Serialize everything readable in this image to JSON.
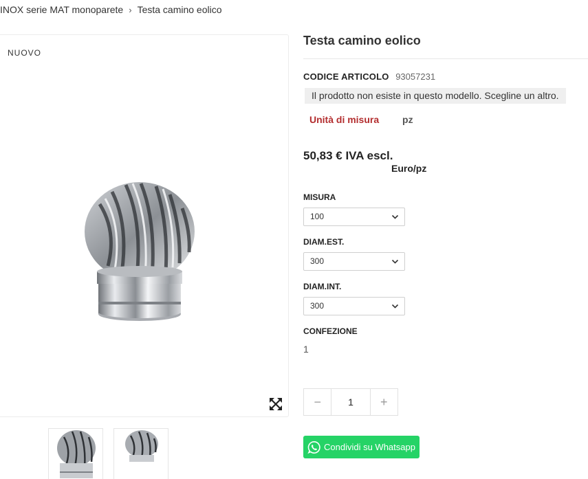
{
  "breadcrumb": {
    "items": [
      "INOX serie MAT monoparete",
      "Testa camino eolico"
    ],
    "separator": "›"
  },
  "gallery": {
    "badge": "NUOVO",
    "expand_icon": "expand-arrows-icon",
    "thumbnails": [
      "thumbnail-front",
      "thumbnail-angle"
    ]
  },
  "product": {
    "title": "Testa camino eolico",
    "reference_label": "CODICE ARTICOLO",
    "reference_value": "93057231",
    "availability_alert": "Il prodotto non esiste in questo modello. Scegline un altro.",
    "unit_label": "Unità di misura",
    "unit_value": "pz",
    "price": "50,83 € IVA escl.",
    "price_unit": "Euro/pz",
    "variants": [
      {
        "label": "MISURA",
        "value": "100"
      },
      {
        "label": "DIAM.EST.",
        "value": "300"
      },
      {
        "label": "DIAM.INT.",
        "value": "300"
      }
    ],
    "confezione_label": "CONFEZIONE",
    "confezione_value": "1",
    "quantity": {
      "value": "1",
      "minus": "−",
      "plus": "+"
    },
    "whatsapp_label": "Condividi su Whatsapp"
  },
  "colors": {
    "accent_red": "#b32d2e",
    "whatsapp_green": "#25d366",
    "alert_bg": "#efefef"
  }
}
